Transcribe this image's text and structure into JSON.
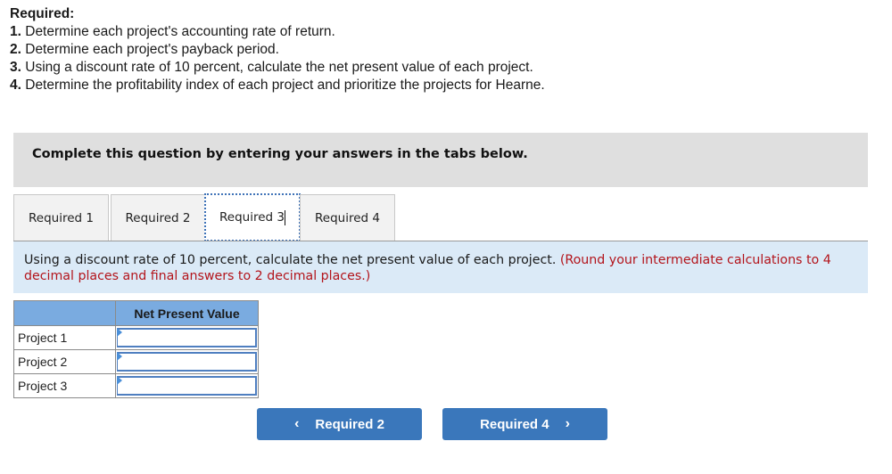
{
  "required": {
    "title": "Required:",
    "items": [
      {
        "num": "1.",
        "text": " Determine each project's accounting rate of return."
      },
      {
        "num": "2.",
        "text": " Determine each project's payback period."
      },
      {
        "num": "3.",
        "text": " Using a discount rate of 10 percent, calculate the net present value of each project."
      },
      {
        "num": "4.",
        "text": " Determine the profitability index of each project and prioritize the projects for Hearne."
      }
    ]
  },
  "banner": "Complete this question by entering your answers in the tabs below.",
  "tabs": [
    {
      "label": "Required 1",
      "active": false
    },
    {
      "label": "Required 2",
      "active": false
    },
    {
      "label": "Required 3",
      "active": true
    },
    {
      "label": "Required 4",
      "active": false
    }
  ],
  "instruction": {
    "text": "Using a discount rate of 10 percent, calculate the net present value of each project.",
    "note": "(Round your intermediate calculations to 4 decimal places and final answers to 2 decimal places.)"
  },
  "table": {
    "header": "Net Present Value",
    "rows": [
      {
        "label": "Project 1",
        "value": ""
      },
      {
        "label": "Project 2",
        "value": ""
      },
      {
        "label": "Project 3",
        "value": ""
      }
    ]
  },
  "nav": {
    "prev_label": "Required 2",
    "next_label": "Required 4",
    "prev_icon": "chevron-left-icon",
    "next_icon": "chevron-right-icon"
  },
  "colors": {
    "button_bg": "#3a77bb",
    "table_header_bg": "#7aabe0",
    "instruction_bg": "#dbeaf7",
    "note_red": "#b3141b",
    "banner_bg": "#dfdfdf"
  }
}
